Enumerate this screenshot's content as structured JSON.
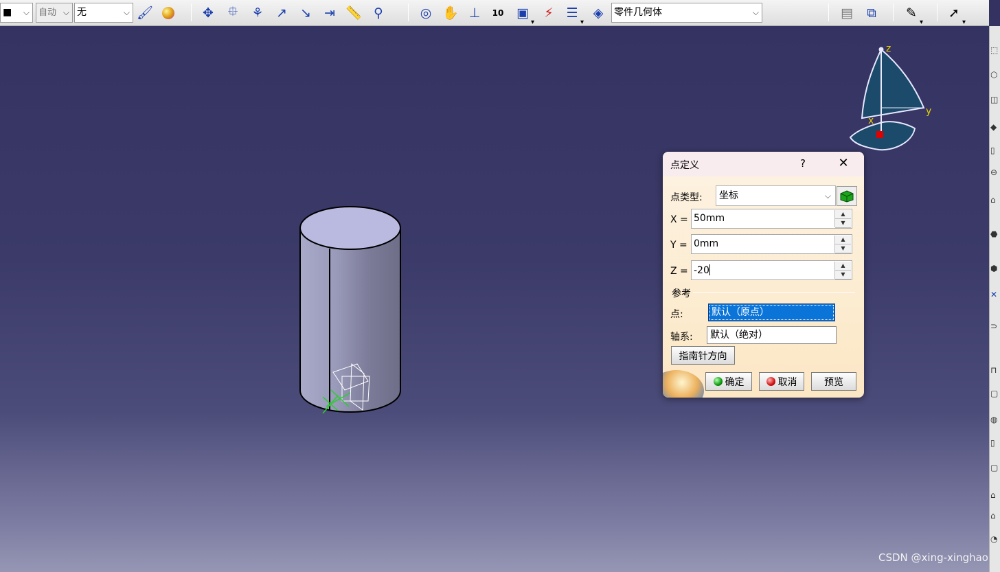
{
  "toolbar": {
    "combo_color": "■",
    "combo_auto": "自动",
    "combo_none": "无",
    "combo_body": "零件几何体"
  },
  "compass": {
    "z": "z",
    "y": "y",
    "x": "x"
  },
  "dialog": {
    "title": "点定义",
    "help": "?",
    "close": "✕",
    "point_type_label": "点类型:",
    "point_type_value": "坐标",
    "x_label": "X =",
    "x_value": "50mm",
    "y_label": "Y =",
    "y_value": "0mm",
    "z_label": "Z =",
    "z_value": "-20",
    "reference_label": "参考",
    "point_label": "点:",
    "point_value": "默认（原点）",
    "axis_label": "轴系:",
    "axis_value": "默认（绝对）",
    "compass_button": "指南针方向",
    "ok_button": "确定",
    "cancel_button": "取消",
    "preview_button": "预览"
  },
  "watermark": "CSDN @xing-xinghao",
  "colors": {
    "viewport_top": "#343260",
    "viewport_bottom": "#9696b4",
    "selection": "#0a74d8",
    "dialog_bg": "#fce7c4"
  }
}
